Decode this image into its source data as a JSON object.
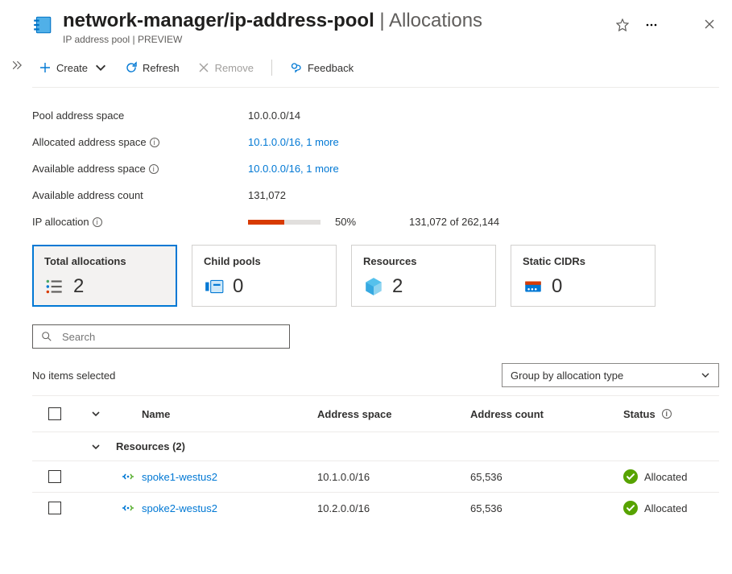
{
  "header": {
    "title_main": "network-manager/ip-address-pool",
    "title_suffix": " | Allocations",
    "breadcrumb": "IP address pool | PREVIEW"
  },
  "toolbar": {
    "create": "Create",
    "refresh": "Refresh",
    "remove": "Remove",
    "feedback": "Feedback"
  },
  "details": {
    "pool_space_label": "Pool address space",
    "pool_space_value": "10.0.0.0/14",
    "allocated_label": "Allocated address space",
    "allocated_value": "10.1.0.0/16, 1 more",
    "available_label": "Available address space",
    "available_value": "10.0.0.0/16, 1 more",
    "count_label": "Available address count",
    "count_value": "131,072",
    "alloc_label": "IP allocation",
    "alloc_pct": "50%",
    "alloc_pct_num": 50,
    "alloc_frac": "131,072 of 262,144"
  },
  "cards": {
    "total": {
      "title": "Total allocations",
      "value": "2"
    },
    "child": {
      "title": "Child pools",
      "value": "0"
    },
    "res": {
      "title": "Resources",
      "value": "2"
    },
    "cidr": {
      "title": "Static CIDRs",
      "value": "0"
    }
  },
  "search": {
    "placeholder": "Search"
  },
  "selection_text": "No items selected",
  "groupby": "Group by allocation type",
  "table": {
    "headers": {
      "name": "Name",
      "addr": "Address space",
      "count": "Address count",
      "status": "Status"
    },
    "group_label": "Resources (2)",
    "rows": [
      {
        "name": "spoke1-westus2",
        "addr": "10.1.0.0/16",
        "count": "65,536",
        "status": "Allocated"
      },
      {
        "name": "spoke2-westus2",
        "addr": "10.2.0.0/16",
        "count": "65,536",
        "status": "Allocated"
      }
    ]
  }
}
